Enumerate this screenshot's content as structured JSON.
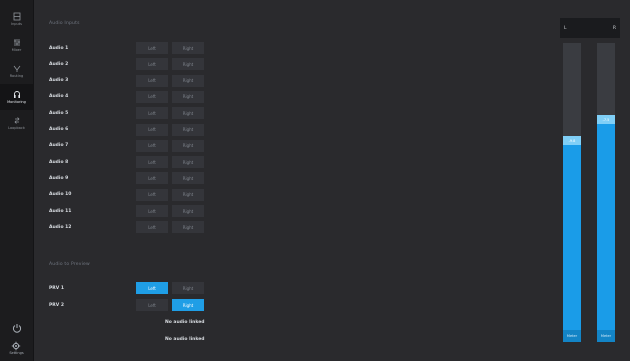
{
  "sidebar": {
    "items": [
      {
        "label": "Inputs",
        "icon": "input-icon"
      },
      {
        "label": "Mixer",
        "icon": "mixer-icon"
      },
      {
        "label": "Routing",
        "icon": "routing-icon"
      },
      {
        "label": "Monitoring",
        "icon": "headphones-icon"
      },
      {
        "label": "Loopback",
        "icon": "loopback-icon"
      }
    ],
    "active_index": 3,
    "settings_label": "Settings"
  },
  "audio_inputs": {
    "title": "Audio Inputs",
    "left_label": "Left",
    "right_label": "Right",
    "rows": [
      "Audio 1",
      "Audio 2",
      "Audio 3",
      "Audio 4",
      "Audio 5",
      "Audio 6",
      "Audio 7",
      "Audio 8",
      "Audio 9",
      "Audio 10",
      "Audio 11",
      "Audio 12"
    ]
  },
  "preview": {
    "title": "Audio to Preview",
    "rows": [
      {
        "label": "PRV 1",
        "left": "Left",
        "right": "Right",
        "selected": "left"
      },
      {
        "label": "PRV 2",
        "left": "Left",
        "right": "Right",
        "selected": "right"
      }
    ],
    "unlinked": [
      {
        "label": "",
        "text": "No audio linked"
      },
      {
        "label": "",
        "text": "No audio linked"
      }
    ]
  },
  "meters": {
    "header_left": "L",
    "header_right": "R",
    "channels": [
      {
        "level": 0.69,
        "peak_label": "-9.8",
        "foot_label": "Meter"
      },
      {
        "level": 0.76,
        "peak_label": "-7.5",
        "foot_label": "Meter"
      }
    ],
    "fill_color": "#1a9ce8",
    "peak_color": "#7fcff7"
  },
  "colors": {
    "accent": "#1f9ee6",
    "background": "#2a2a2d",
    "sidebar": "#1c1c1e"
  }
}
